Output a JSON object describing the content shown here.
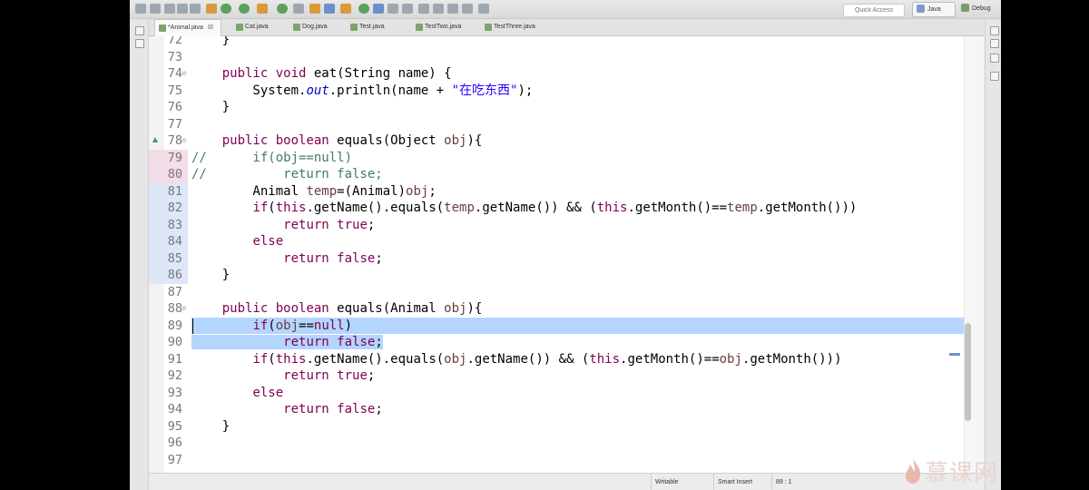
{
  "toolbar": {
    "quick_access_placeholder": "Quick Access",
    "perspective_java": "Java",
    "perspective_debug": "Debug"
  },
  "tabs": [
    {
      "label": "*Animal.java",
      "close": "☒",
      "active": true
    },
    {
      "label": "Cat.java",
      "active": false
    },
    {
      "label": "Dog.java",
      "active": false
    },
    {
      "label": "Test.java",
      "active": false
    },
    {
      "label": "TestTwo.java",
      "active": false
    },
    {
      "label": "TestThree.java",
      "active": false
    }
  ],
  "editor": {
    "lines": [
      {
        "n": "72",
        "html": "    }"
      },
      {
        "n": "73",
        "html": ""
      },
      {
        "n": "74",
        "fold": "⊖",
        "html": "    <span class=\"kw\">public void</span> eat(String name) {"
      },
      {
        "n": "75",
        "html": "        System.<span class=\"fld\">out</span>.println(name + <span class=\"str\">\"在吃东西\"</span>);"
      },
      {
        "n": "76",
        "html": "    }"
      },
      {
        "n": "77",
        "html": ""
      },
      {
        "n": "78",
        "fold": "⊖",
        "override": true,
        "html": "    <span class=\"kw\">public boolean</span> equals(Object <span class=\"var\">obj</span>){"
      },
      {
        "n": "79",
        "pink": true,
        "html": "<span class=\"com\">//      if(obj==null)</span>"
      },
      {
        "n": "80",
        "pink": true,
        "html": "<span class=\"com\">//          return false;</span>"
      },
      {
        "n": "81",
        "blue": true,
        "html": "        Animal <span class=\"var\">temp</span>=(Animal)<span class=\"var\">obj</span>;"
      },
      {
        "n": "82",
        "blue": true,
        "html": "        <span class=\"kw\">if</span>(<span class=\"kw\">this</span>.getName().equals(<span class=\"var\">temp</span>.getName()) &amp;&amp; (<span class=\"kw\">this</span>.getMonth()==<span class=\"var\">temp</span>.getMonth()))"
      },
      {
        "n": "83",
        "blue": true,
        "html": "            <span class=\"kw\">return true</span>;"
      },
      {
        "n": "84",
        "blue": true,
        "html": "        <span class=\"kw\">else</span>"
      },
      {
        "n": "85",
        "blue": true,
        "html": "            <span class=\"kw\">return false</span>;"
      },
      {
        "n": "86",
        "blue": true,
        "html": "    }"
      },
      {
        "n": "87",
        "html": ""
      },
      {
        "n": "88",
        "fold": "⊖",
        "html": "    <span class=\"kw\">public boolean</span> equals(Animal <span class=\"var\">obj</span>){"
      },
      {
        "n": "89",
        "selfull": true,
        "html": "        <span class=\"kw\">if</span>(<span class=\"var\">obj</span>==<span class=\"kw\">null</span>)"
      },
      {
        "n": "90",
        "selpart": true,
        "html": "<span class=\"sel\">            <span class=\"kw\">return false</span>;</span>"
      },
      {
        "n": "91",
        "html": "        <span class=\"kw\">if</span>(<span class=\"kw\">this</span>.getName().equals(<span class=\"var\">obj</span>.getName()) &amp;&amp; (<span class=\"kw\">this</span>.getMonth()==<span class=\"var\">obj</span>.getMonth()))"
      },
      {
        "n": "92",
        "html": "            <span class=\"kw\">return true</span>;"
      },
      {
        "n": "93",
        "html": "        <span class=\"kw\">else</span>"
      },
      {
        "n": "94",
        "html": "            <span class=\"kw\">return false</span>;"
      },
      {
        "n": "95",
        "html": "    }"
      },
      {
        "n": "96",
        "html": ""
      },
      {
        "n": "97",
        "html": ""
      }
    ]
  },
  "status": {
    "writable": "Writable",
    "insert_mode": "Smart Insert",
    "position": "89 : 1"
  },
  "watermark": {
    "text": "慕课网"
  }
}
